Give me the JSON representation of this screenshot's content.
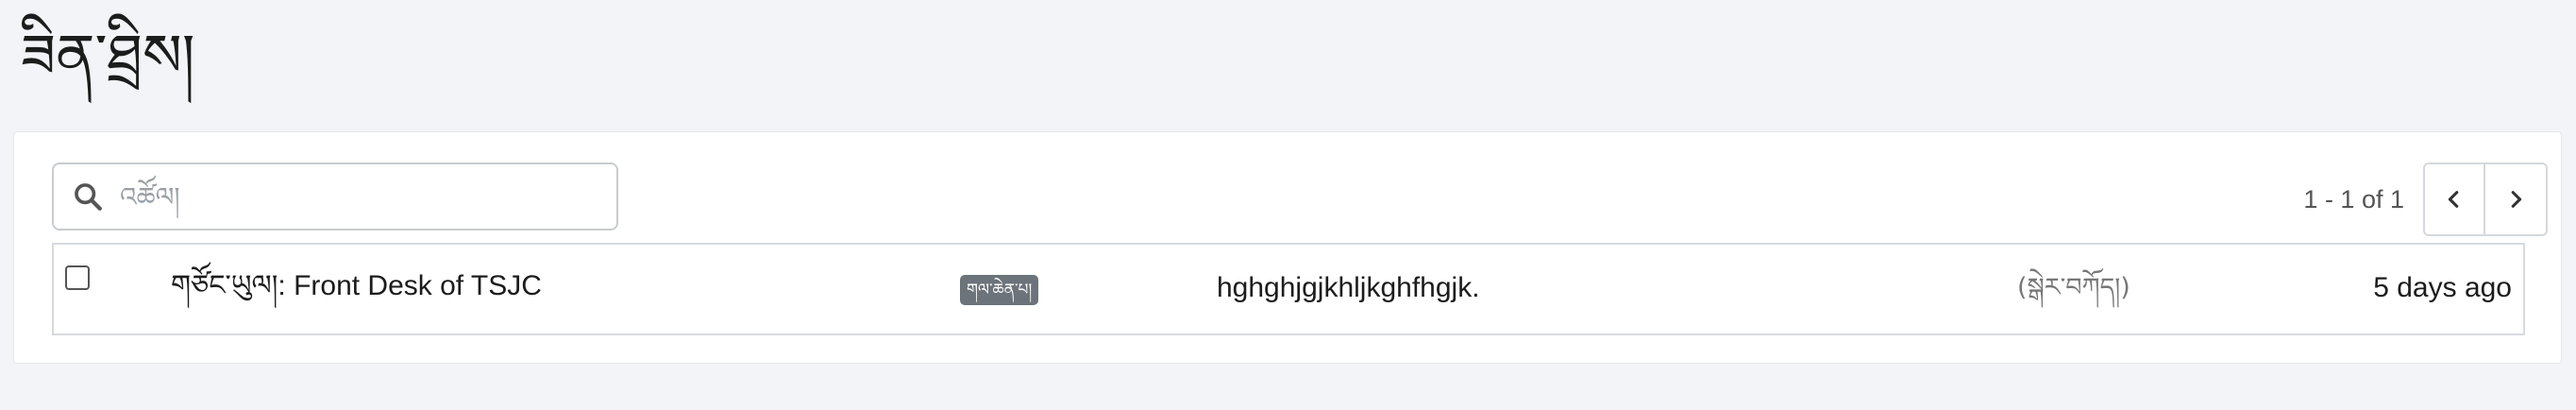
{
  "page": {
    "title": "ཟིན་ཐྲིས།"
  },
  "search": {
    "placeholder": "འཚོལ།",
    "value": ""
  },
  "pagination": {
    "range_text": "1 - 1 of 1"
  },
  "rows": [
    {
      "name": "གཙོང་ཡུལ།: Front Desk of TSJC",
      "badge": "གལ་ཆེན་པ།",
      "description": "hghghjgjkhljkghfhgjk.",
      "status": "(སྒེར་བཀོད།)",
      "time": "5 days ago"
    }
  ],
  "icons": {
    "search": "search-icon",
    "prev": "chevron-left-icon",
    "next": "chevron-right-icon"
  }
}
